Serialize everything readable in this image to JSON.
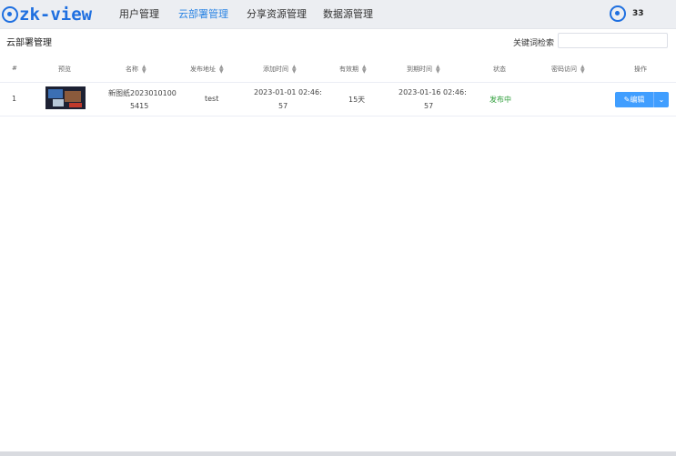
{
  "app": {
    "logo_text": "zk-view"
  },
  "nav": [
    {
      "label": "用户管理",
      "active": false
    },
    {
      "label": "云部署管理",
      "active": true
    },
    {
      "label": "分享资源管理",
      "active": false
    },
    {
      "label": "数据源管理",
      "active": false
    }
  ],
  "user": {
    "name": "33"
  },
  "page": {
    "title": "云部署管理"
  },
  "search": {
    "label": "关键词检索",
    "value": "",
    "placeholder": ""
  },
  "table": {
    "columns": [
      "#",
      "预览",
      "名称",
      "发布地址",
      "添加时间",
      "有效期",
      "到期时间",
      "状态",
      "密码访问",
      "操作"
    ],
    "rows": [
      {
        "index": "1",
        "name_line1": "新图纸2023010100",
        "name_line2": "5415",
        "address": "test",
        "added_line1": "2023-01-01 02:46:",
        "added_line2": "57",
        "validity": "15天",
        "expire_line1": "2023-01-16 02:46:",
        "expire_line2": "57",
        "status": "发布中",
        "password": "",
        "action": "编辑"
      }
    ]
  },
  "colors": {
    "accent": "#409eff",
    "status_green": "#2e9e3a",
    "brand": "#1e6fe0"
  }
}
